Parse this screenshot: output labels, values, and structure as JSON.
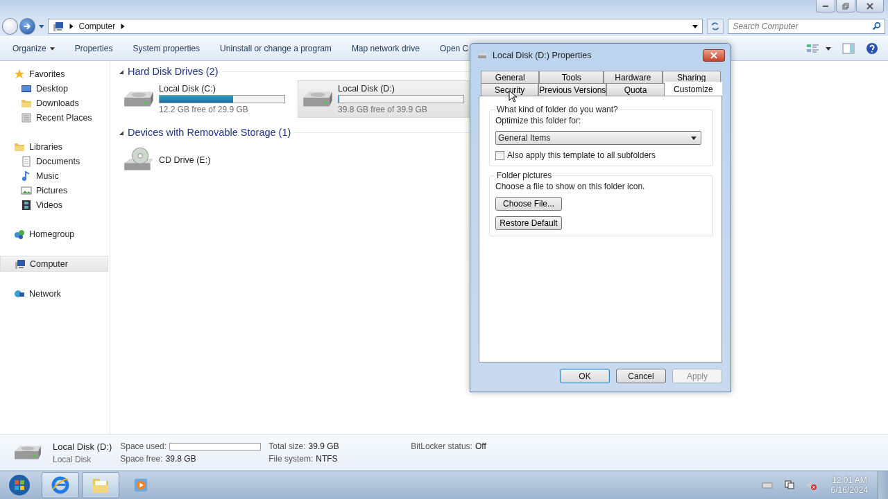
{
  "address_bar": {
    "path": "Computer"
  },
  "search": {
    "placeholder": "Search Computer"
  },
  "toolbar": {
    "items": [
      {
        "label": "Organize",
        "kind": "menu"
      },
      {
        "label": "Properties",
        "kind": "button"
      },
      {
        "label": "System properties",
        "kind": "button"
      },
      {
        "label": "Uninstall or change a program",
        "kind": "button"
      },
      {
        "label": "Map network drive",
        "kind": "button"
      },
      {
        "label": "Open C",
        "kind": "button"
      }
    ]
  },
  "sidebar": {
    "groups": [
      {
        "label": "Favorites",
        "selected": false,
        "children": [
          {
            "label": "Desktop",
            "selected": false
          },
          {
            "label": "Downloads",
            "selected": false
          },
          {
            "label": "Recent Places",
            "selected": false
          }
        ]
      },
      {
        "label": "Libraries",
        "selected": false,
        "children": [
          {
            "label": "Documents",
            "selected": false
          },
          {
            "label": "Music",
            "selected": false
          },
          {
            "label": "Pictures",
            "selected": false
          },
          {
            "label": "Videos",
            "selected": false
          }
        ]
      },
      {
        "label": "Homegroup",
        "selected": false
      },
      {
        "label": "Computer",
        "selected": true
      },
      {
        "label": "Network",
        "selected": false
      }
    ]
  },
  "content": {
    "groups": [
      {
        "title": "Hard Disk Drives (2)",
        "expanded": true,
        "items": [
          {
            "kind": "disk",
            "name": "Local Disk (C:)",
            "level": 0.59,
            "free": "12.2 GB free of 29.9 GB",
            "selected": false
          },
          {
            "kind": "disk",
            "name": "Local Disk (D:)",
            "level": 0.003,
            "free": "39.8 GB free of 39.9 GB",
            "selected": true
          }
        ]
      },
      {
        "title": "Devices with Removable Storage (1)",
        "expanded": true,
        "items": [
          {
            "kind": "cd",
            "name": "CD Drive (E:)",
            "selected": false
          }
        ]
      }
    ]
  },
  "details": {
    "name": "Local Disk (D:)",
    "type": "Local Disk",
    "fields": [
      {
        "label": "Space used:",
        "kind": "bar",
        "level": 0.003
      },
      {
        "label": "Total size:",
        "kind": "text",
        "value": "39.9 GB"
      },
      {
        "label": "BitLocker status:",
        "kind": "text",
        "value": "Off"
      },
      {
        "label": "Space free:",
        "kind": "text",
        "value": "39.8 GB"
      },
      {
        "label": "File system:",
        "kind": "text",
        "value": "NTFS"
      }
    ]
  },
  "dialog": {
    "title": "Local Disk (D:) Properties",
    "tab_rows": [
      {
        "tabs": [
          {
            "label": "General",
            "selected": false
          },
          {
            "label": "Tools",
            "selected": false
          },
          {
            "label": "Hardware",
            "selected": false
          },
          {
            "label": "Sharing",
            "selected": false
          }
        ]
      },
      {
        "tabs": [
          {
            "label": "Security",
            "selected": false
          },
          {
            "label": "Previous Versions",
            "selected": false
          },
          {
            "label": "Quota",
            "selected": false
          },
          {
            "label": "Customize",
            "selected": true
          }
        ]
      }
    ],
    "folder_type": {
      "title": "What kind of folder do you want?",
      "label": "Optimize this folder for:",
      "dropdown": {
        "value": "General Items"
      },
      "checkbox": {
        "label": "Also apply this template to all subfolders",
        "checked": false
      }
    },
    "folder_pictures": {
      "title": "Folder pictures",
      "text": "Choose a file to show on this folder icon.",
      "buttons": [
        "Choose File...",
        "Restore Default"
      ]
    },
    "buttons": [
      {
        "label": "OK",
        "disabled": false,
        "default": true
      },
      {
        "label": "Cancel",
        "disabled": false,
        "default": false
      },
      {
        "label": "Apply",
        "disabled": true,
        "default": false
      }
    ]
  },
  "taskbar": {
    "apps": [
      {
        "kind": "browser",
        "running": true
      },
      {
        "kind": "folder",
        "running": true
      },
      {
        "kind": "media",
        "running": false
      }
    ],
    "clock": {
      "time": "12:01 AM",
      "date": "6/16/2024"
    }
  }
}
